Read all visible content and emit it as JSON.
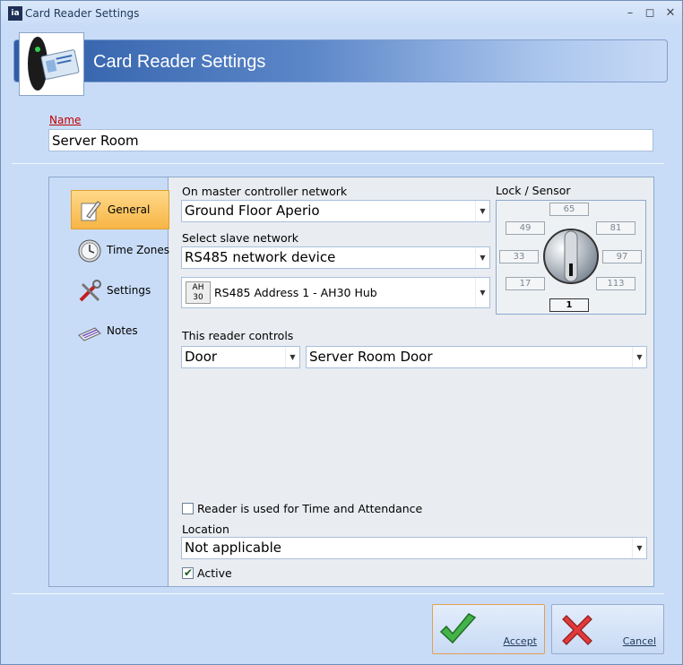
{
  "window": {
    "title": "Card Reader Settings",
    "app_icon_text": "ia"
  },
  "banner": {
    "title": "Card Reader Settings"
  },
  "name": {
    "label": "Name",
    "value": "Server Room"
  },
  "nav": {
    "items": [
      {
        "label": "General",
        "icon": "general-pencil-icon",
        "active": true
      },
      {
        "label": "Time Zones",
        "icon": "clock-icon",
        "active": false
      },
      {
        "label": "Settings",
        "icon": "tools-icon",
        "active": false
      },
      {
        "label": "Notes",
        "icon": "notes-icon",
        "active": false
      }
    ]
  },
  "general": {
    "master_network_label": "On master controller network",
    "master_network_value": "Ground Floor Aperio",
    "slave_network_label": "Select slave network",
    "slave_network_value": "RS485 network device",
    "device_badge": "AH 30",
    "device_value": "RS485 Address 1 - AH30 Hub",
    "controls_label": "This reader controls",
    "controls_type_value": "Door",
    "controls_target_value": "Server Room Door",
    "time_attendance_label": "Reader is used for Time and Attendance",
    "time_attendance_checked": false,
    "location_label": "Location",
    "location_value": "Not applicable",
    "active_label": "Active",
    "active_checked": true
  },
  "lock_sensor": {
    "label": "Lock / Sensor",
    "cells": [
      "65",
      "49",
      "81",
      "33",
      "97",
      "17",
      "113",
      "1"
    ],
    "selected": "1"
  },
  "actions": {
    "accept_label": "Accept",
    "cancel_label": "Cancel"
  },
  "colors": {
    "accent": "#f7b545",
    "banner": "#2f5ea8",
    "background": "#c9dcf7",
    "error_label": "#c00000"
  }
}
